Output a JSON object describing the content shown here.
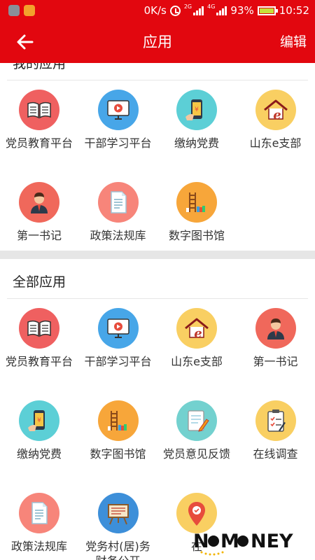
{
  "status_bar": {
    "speed": "0K/s",
    "net_label_1": "2G",
    "net_label_2": "4G",
    "battery": "93%",
    "time": "10:52"
  },
  "header": {
    "title": "应用",
    "edit_label": "编辑"
  },
  "my_apps": {
    "title": "我的应用",
    "items": [
      {
        "label": "党员教育平台",
        "icon": "book-icon",
        "color": "#ef6060"
      },
      {
        "label": "干部学习平台",
        "icon": "monitor-play-icon",
        "color": "#47a6e8"
      },
      {
        "label": "缴纳党费",
        "icon": "phone-pay-icon",
        "color": "#5ccfd6"
      },
      {
        "label": "山东e支部",
        "icon": "house-e-icon",
        "color": "#f9cf62"
      },
      {
        "label": "第一书记",
        "icon": "person-icon",
        "color": "#f0685b"
      },
      {
        "label": "政策法规库",
        "icon": "document-icon",
        "color": "#f7857a"
      },
      {
        "label": "数字图书馆",
        "icon": "bookshelf-icon",
        "color": "#f7a63a"
      }
    ]
  },
  "all_apps": {
    "title": "全部应用",
    "items": [
      {
        "label": "党员教育平台",
        "icon": "book-icon",
        "color": "#ef6060"
      },
      {
        "label": "干部学习平台",
        "icon": "monitor-play-icon",
        "color": "#47a6e8"
      },
      {
        "label": "山东e支部",
        "icon": "house-e-icon",
        "color": "#f9cf62"
      },
      {
        "label": "第一书记",
        "icon": "person-icon",
        "color": "#f0685b"
      },
      {
        "label": "缴纳党费",
        "icon": "phone-pay-icon",
        "color": "#5ccfd6"
      },
      {
        "label": "数字图书馆",
        "icon": "bookshelf-icon",
        "color": "#f7a63a"
      },
      {
        "label": "党员意见反馈",
        "icon": "notepad-pencil-icon",
        "color": "#73d1cf"
      },
      {
        "label": "在线调查",
        "icon": "clipboard-check-icon",
        "color": "#f9cf62"
      },
      {
        "label": "政策法规库",
        "icon": "document-icon",
        "color": "#f7857a"
      },
      {
        "label": "党务村(居)务财务公开",
        "icon": "board-icon",
        "color": "#3d8fd9"
      },
      {
        "label": "在",
        "icon": "location-pin-icon",
        "color": "#f9cf62"
      }
    ]
  },
  "watermark": {
    "text": "NOMONEY"
  },
  "colors": {
    "accent": "#e2070f"
  }
}
